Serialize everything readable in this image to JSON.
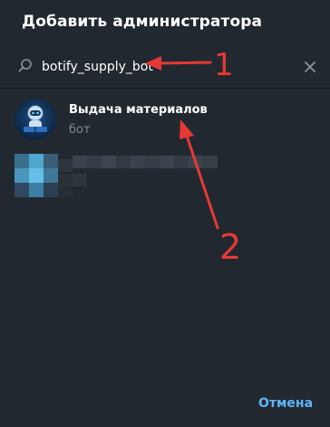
{
  "dialog": {
    "title": "Добавить администратора",
    "cancel_label": "Отмена"
  },
  "search": {
    "value": "botify_supply_bot",
    "icon": "search-icon",
    "clear_icon": "close-icon"
  },
  "results": [
    {
      "name": "Выдача материалов",
      "status": "бот"
    }
  ],
  "annotations": {
    "marker_1": "1",
    "marker_2": "2",
    "color": "#e53935"
  },
  "colors": {
    "background": "#222830",
    "accent": "#5eb5f7",
    "secondary_text": "#7f8b95"
  }
}
